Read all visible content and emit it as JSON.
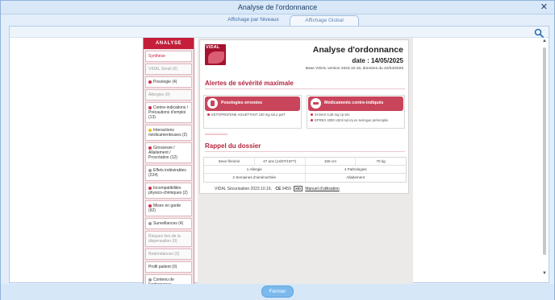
{
  "window": {
    "title": "Analyse de l'ordonnance",
    "close_symbol": "✕"
  },
  "tabs": [
    {
      "label": "Affichage par Niveaux",
      "active": false
    },
    {
      "label": "Affichage Global",
      "active": true
    }
  ],
  "nav": {
    "header": "ANALYSE",
    "items": [
      {
        "label": "Synthèse",
        "indicator": "none",
        "state": "selected"
      },
      {
        "label": "VIDAL Sérail (0)",
        "indicator": "none",
        "state": "dim"
      },
      {
        "label": "Posologie (4)",
        "indicator": "red",
        "state": "normal"
      },
      {
        "label": "Allergies (0)",
        "indicator": "none",
        "state": "dim"
      },
      {
        "label": "Contre-indications / Précautions d'emploi (13)",
        "indicator": "red",
        "state": "normal"
      },
      {
        "label": "Interactions médicamenteuses (2)",
        "indicator": "yellow",
        "state": "normal"
      },
      {
        "label": "Grossesse / Allaitement / Procréation (12)",
        "indicator": "red",
        "state": "normal"
      },
      {
        "label": "Effets indésirables (224)",
        "indicator": "grey",
        "state": "normal"
      },
      {
        "label": "Incompatibilités physico-chimiques (2)",
        "indicator": "red",
        "state": "normal"
      },
      {
        "label": "Mises en garde (92)",
        "indicator": "red",
        "state": "normal"
      },
      {
        "label": "Surveillances (4)",
        "indicator": "grey",
        "state": "normal"
      },
      {
        "label": "Risques lors de la dispensation (0)",
        "indicator": "none",
        "state": "dim"
      },
      {
        "label": "Redondances (0)",
        "indicator": "none",
        "state": "dim"
      },
      {
        "label": "Profil patient (0)",
        "indicator": "none",
        "state": "normal"
      },
      {
        "label": "Contenu de l'ordonnance",
        "indicator": "grey",
        "state": "normal"
      }
    ]
  },
  "doc": {
    "logo_text": "VIDAL",
    "title": "Analyse d'ordonnance",
    "date": "date : 14/05/2025",
    "base": "Base VIDAL version 2023.10.19, données du 22/04/2025",
    "section_alerts": "Alertes de sévérité maximale",
    "alerts": [
      {
        "label": "Posologies erronées",
        "lines": [
          "KETOPROFENE AGUETTANT 100 mg sol p perf"
        ]
      },
      {
        "label": "Médicaments contre-indiqués",
        "lines": [
          "XANAX 0,25 mg cp séc",
          "EPREX 4000 UI/ml sol inj en seringue préremplie"
        ]
      }
    ],
    "section_recall": "Rappel du dossier",
    "table_rows": [
      [
        "Sexe féminin",
        "47 ans   (14/07/1977)",
        "166  cm",
        "70  kg"
      ],
      [
        "1 Allergie",
        "4 Pathologies"
      ],
      [
        "2 Semaines d'aménorrhée",
        "Allaitement"
      ]
    ],
    "footer_text": "VIDAL Sécurisation 2023.10.19,",
    "footer_ce": "CE",
    "footer_num": "0459",
    "footer_md": "MD",
    "footer_link": "Manuel d'utilisation"
  },
  "bottom": {
    "close_button": "Fermer"
  },
  "colors": {
    "accent_red": "#c41e3a",
    "alert_red": "#c9455b",
    "window_blue": "#d8e8f8",
    "button_blue": "#7bb9ec"
  }
}
